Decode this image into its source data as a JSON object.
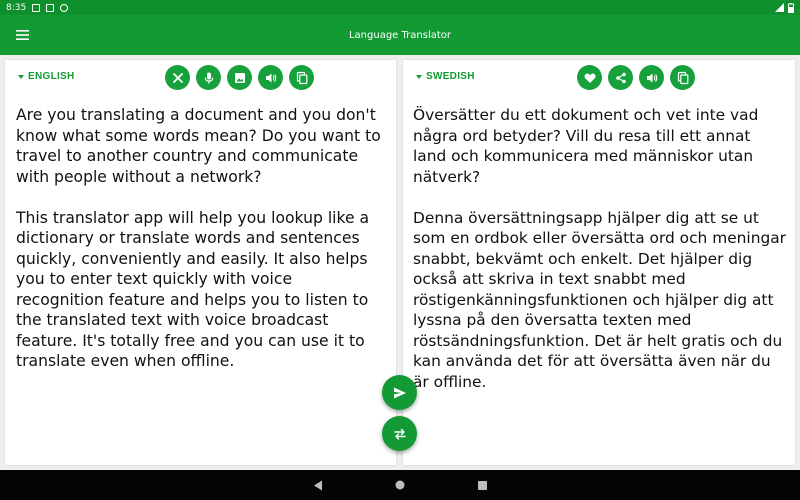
{
  "status_bar": {
    "time": "8:35"
  },
  "app_bar": {
    "title": "Language Translator",
    "menu_icon": "hamburger-menu-icon"
  },
  "source_panel": {
    "language": "ENGLISH",
    "actions": [
      "clear-icon",
      "microphone-icon",
      "image-icon",
      "speaker-icon",
      "copy-icon"
    ],
    "paragraphs": [
      "Are you translating a document and you don't know what some words mean? Do you want to travel to another country and communicate with people without a network?",
      "This translator app will help you lookup like a dictionary or translate words and sentences quickly, conveniently and easily. It also helps you to enter text quickly with voice recognition feature and helps you to listen to the translated text with voice broadcast feature. It's totally free and you can use it to translate even when offline."
    ]
  },
  "target_panel": {
    "language": "SWEDISH",
    "actions": [
      "favorite-icon",
      "share-icon",
      "speaker-icon",
      "copy-icon"
    ],
    "paragraphs": [
      "Översätter du ett dokument och vet inte vad några ord betyder? Vill du resa till ett annat land och kommunicera med människor utan nätverk?",
      "Denna översättningsapp hjälper dig att se ut som en ordbok eller översätta ord och meningar snabbt, bekvämt och enkelt. Det hjälper dig också att skriva in text snabbt med röstigenkänningsfunktionen och hjälper dig att lyssna på den översatta texten med röstsändningsfunktion. Det är helt gratis och du kan använda det för att översätta även när du är offline."
    ]
  },
  "fabs": [
    "send-icon",
    "swap-icon"
  ],
  "colors": {
    "status_bar": "#108f2d",
    "app_bar": "#129b32",
    "accent": "#149a35",
    "nav_bar": "#050505"
  }
}
